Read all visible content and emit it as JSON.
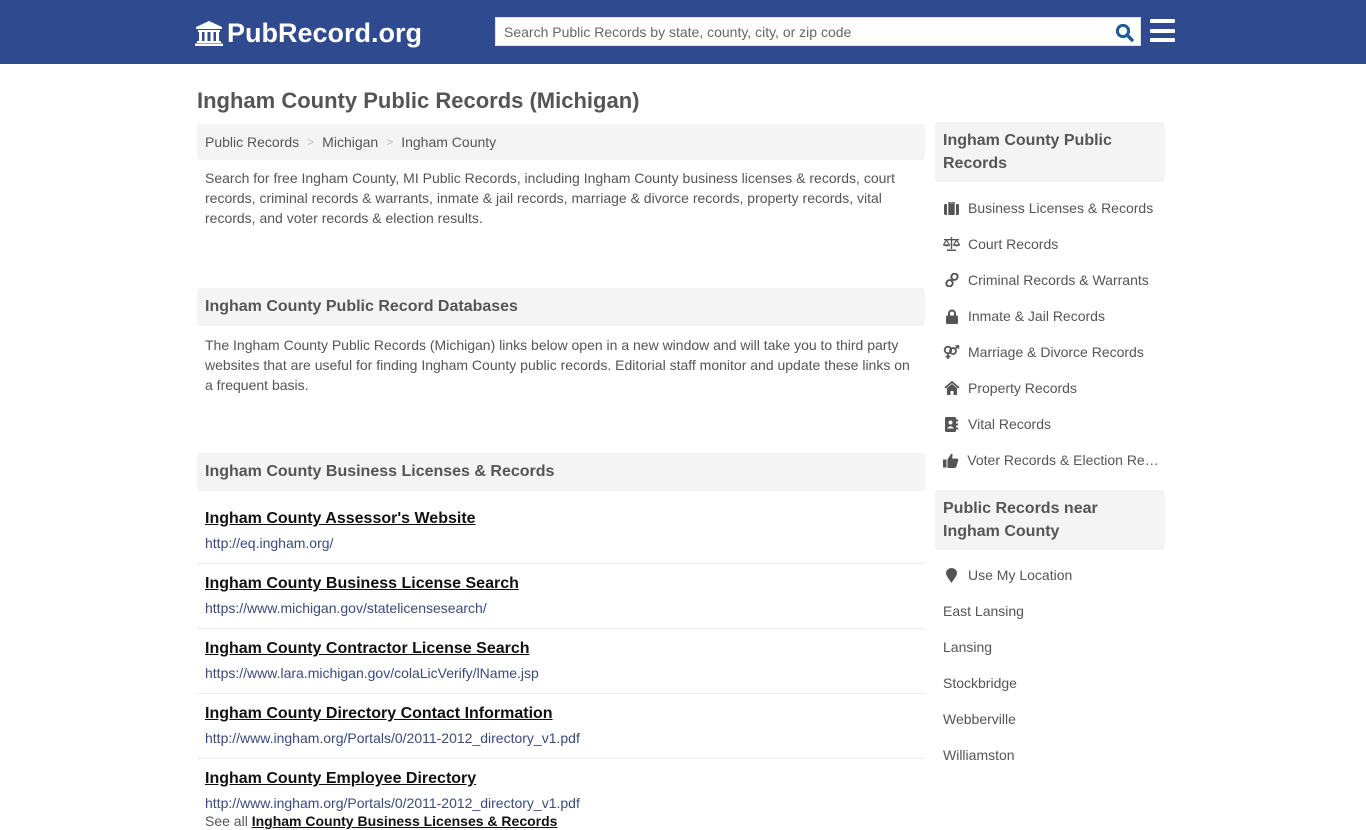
{
  "header": {
    "logo_text": "PubRecord.org",
    "logo_icon": "courthouse-icon",
    "search_placeholder": "Search Public Records by state, county, city, or zip code",
    "search_value": "",
    "search_icon": "search-icon",
    "menu_icon": "hamburger-menu-icon",
    "colors": {
      "bar": "#2f4a8f",
      "search_icon": "#1f5a96"
    }
  },
  "page_title": "Ingham County Public Records (Michigan)",
  "breadcrumb": [
    {
      "label": "Public Records"
    },
    {
      "label": "Michigan"
    },
    {
      "label": "Ingham County"
    }
  ],
  "breadcrumb_separator": ">",
  "intro": "Search for free Ingham County, MI Public Records, including Ingham County business licenses & records, court records, criminal records & warrants, inmate & jail records, marriage & divorce records, property records, vital records, and voter records & election results.",
  "databases": {
    "heading": "Ingham County Public Record Databases",
    "description": "The Ingham County Public Records (Michigan) links below open in a new window and will take you to third party websites that are useful for finding Ingham County public records. Editorial staff monitor and update these links on a frequent basis."
  },
  "business_section": {
    "heading": "Ingham County Business Licenses & Records",
    "links": [
      {
        "title": "Ingham County Assessor's Website",
        "url": "http://eq.ingham.org/"
      },
      {
        "title": "Ingham County Business License Search",
        "url": "https://www.michigan.gov/statelicensesearch/"
      },
      {
        "title": "Ingham County Contractor License Search",
        "url": "https://www.lara.michigan.gov/colaLicVerify/lName.jsp"
      },
      {
        "title": "Ingham County Directory Contact Information",
        "url": "http://www.ingham.org/Portals/0/2011-2012_directory_v1.pdf"
      },
      {
        "title": "Ingham County Employee Directory",
        "url": "http://www.ingham.org/Portals/0/2011-2012_directory_v1.pdf"
      }
    ],
    "see_all_prefix": "See all",
    "see_all_link": "Ingham County Business Licenses & Records"
  },
  "sidebar": {
    "records_heading": "Ingham County Public Records",
    "records": [
      {
        "label": "Business Licenses & Records",
        "icon": "briefcase-icon"
      },
      {
        "label": "Court Records",
        "icon": "scales-icon"
      },
      {
        "label": "Criminal Records & Warrants",
        "icon": "link-icon"
      },
      {
        "label": "Inmate & Jail Records",
        "icon": "lock-icon"
      },
      {
        "label": "Marriage & Divorce Records",
        "icon": "gender-icon"
      },
      {
        "label": "Property Records",
        "icon": "home-icon"
      },
      {
        "label": "Vital Records",
        "icon": "address-book-icon"
      },
      {
        "label": "Voter Records & Election Results",
        "icon": "thumbs-up-icon"
      }
    ],
    "nearby_heading": "Public Records near Ingham County",
    "use_location": {
      "label": "Use My Location",
      "icon": "map-marker-icon"
    },
    "nearby": [
      {
        "label": "East Lansing"
      },
      {
        "label": "Lansing"
      },
      {
        "label": "Stockbridge"
      },
      {
        "label": "Webberville"
      },
      {
        "label": "Williamston"
      }
    ]
  }
}
